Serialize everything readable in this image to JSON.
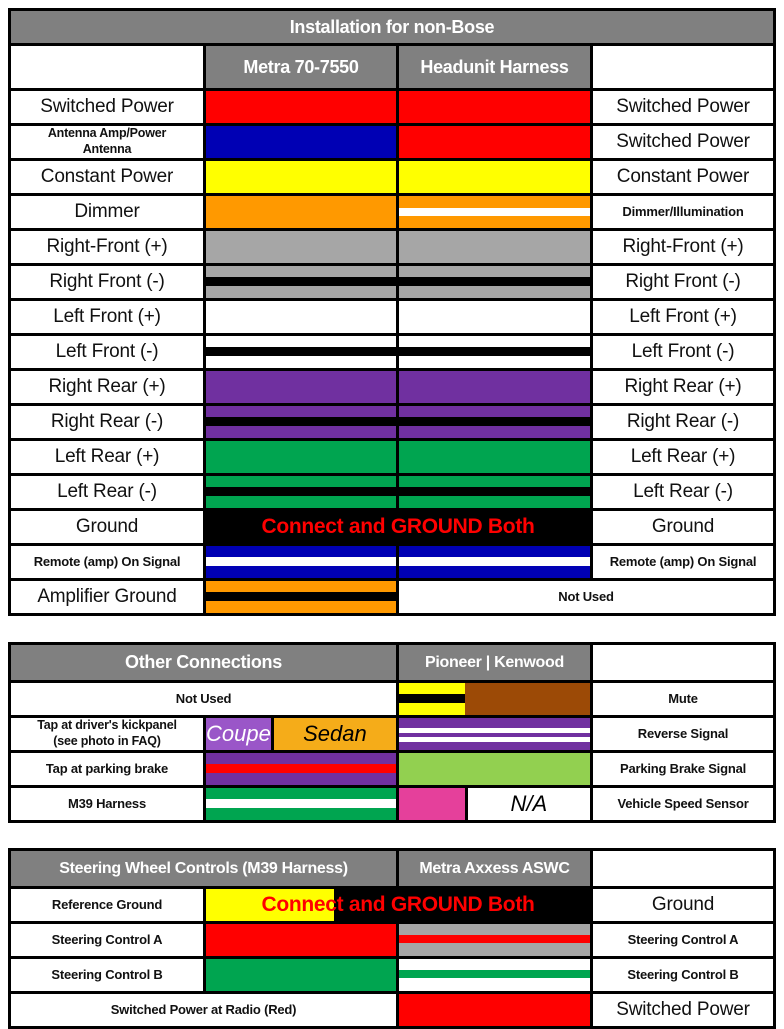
{
  "colors": {
    "red": "#ff0000",
    "blue": "#0000b4",
    "yellow": "#ffff00",
    "orange": "#ff9900",
    "gray": "#a6a6a6",
    "white": "#ffffff",
    "black": "#000000",
    "purple": "#7030a0",
    "green": "#00a550",
    "brown": "#9c4a06",
    "lightgreen": "#92d050",
    "pink": "#e5409b",
    "amber": "#f5ac19",
    "violet": "#9a56c8",
    "header_gray": "#808080",
    "accent_red_text": "#ff0000"
  },
  "table1": {
    "title": "Installation for non-Bose",
    "col_headers": [
      "",
      "Metra 70-7550",
      "Headunit Harness",
      ""
    ],
    "rows": [
      {
        "left": "Switched Power",
        "right": "Switched Power",
        "left_small": false,
        "right_small": false
      },
      {
        "left": "Antenna Amp/Power\nAntenna",
        "right": "Switched Power",
        "left_small": true,
        "right_small": false
      },
      {
        "left": "Constant Power",
        "right": "Constant Power",
        "left_small": false,
        "right_small": false
      },
      {
        "left": "Dimmer",
        "right": "Dimmer/Illumination",
        "left_small": false,
        "right_small": true
      },
      {
        "left": "Right-Front (+)",
        "right": "Right-Front (+)",
        "left_small": false,
        "right_small": false
      },
      {
        "left": "Right Front (-)",
        "right": "Right Front (-)",
        "left_small": false,
        "right_small": false
      },
      {
        "left": "Left Front (+)",
        "right": "Left Front (+)",
        "left_small": false,
        "right_small": false
      },
      {
        "left": "Left Front (-)",
        "right": "Left Front (-)",
        "left_small": false,
        "right_small": false
      },
      {
        "left": "Right Rear (+)",
        "right": "Right Rear (+)",
        "left_small": false,
        "right_small": false
      },
      {
        "left": "Right Rear (-)",
        "right": "Right Rear (-)",
        "left_small": false,
        "right_small": false
      },
      {
        "left": "Left Rear (+)",
        "right": "Left Rear (+)",
        "left_small": false,
        "right_small": false
      },
      {
        "left": "Left Rear (-)",
        "right": "Left Rear (-)",
        "left_small": false,
        "right_small": false
      },
      {
        "left": "Ground",
        "right": "Ground",
        "left_small": false,
        "right_small": false
      },
      {
        "left": "Remote (amp) On Signal",
        "right": "Remote (amp) On Signal",
        "left_small": true,
        "right_small": true
      },
      {
        "left": "Amplifier Ground",
        "right": "Not Used",
        "left_small": false,
        "right_small": true
      }
    ],
    "ground_note": "Connect and GROUND Both",
    "not_used": "Not Used"
  },
  "table2": {
    "col_headers": [
      "Other Connections",
      "Pioneer | Kenwood",
      ""
    ],
    "rows": [
      {
        "left": "Not Used",
        "right": "Mute",
        "left_small": true
      },
      {
        "left": "Tap at driver's kickpanel\n(see photo in FAQ)",
        "right": "Reverse Signal",
        "left_small": true
      },
      {
        "left": "Tap at parking brake",
        "right": "Parking Brake Signal",
        "left_small": true
      },
      {
        "left": "M39 Harness",
        "right": "Vehicle Speed Sensor",
        "left_small": true
      }
    ],
    "coupe_label": "Coupe",
    "sedan_label": "Sedan",
    "na_label": "N/A"
  },
  "table3": {
    "col_headers": [
      "Steering Wheel Controls (M39 Harness)",
      "Metra Axxess ASWC",
      ""
    ],
    "rows": [
      {
        "left": "Reference Ground",
        "right": "Ground",
        "left_small": true,
        "right_small": false
      },
      {
        "left": "Steering Control A",
        "right": "Steering Control A",
        "left_small": true,
        "right_small": true
      },
      {
        "left": "Steering Control B",
        "right": "Steering Control B",
        "left_small": true,
        "right_small": true
      },
      {
        "left": "Switched Power at Radio (Red)",
        "right": "Switched Power",
        "left_small": true,
        "right_small": false
      }
    ],
    "ground_note": "Connect and GROUND Both"
  }
}
